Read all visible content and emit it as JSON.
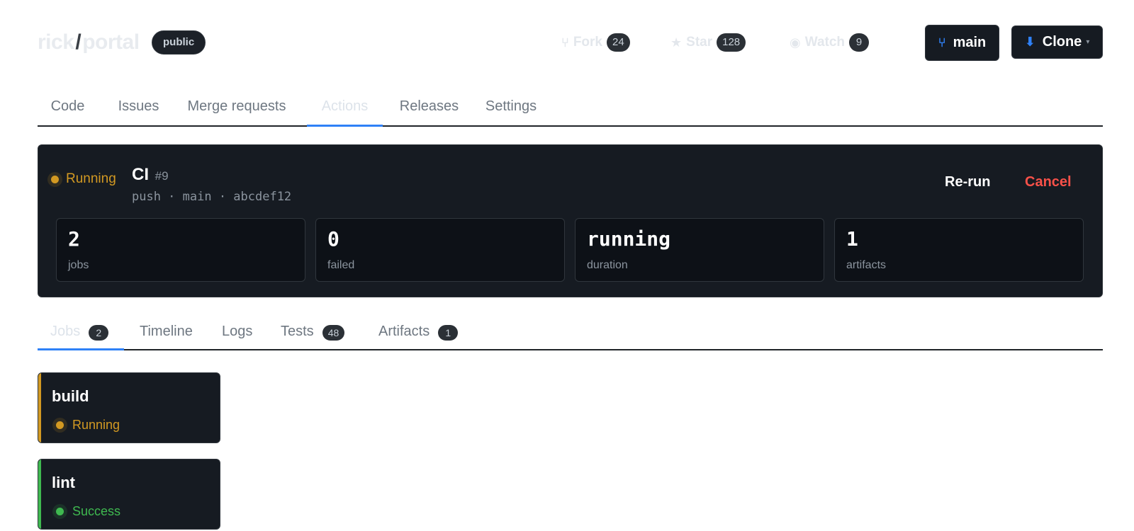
{
  "repo": {
    "owner": "rick",
    "separator": "/",
    "name": "portal",
    "visibility": "public",
    "fork": {
      "label": "Fork",
      "count": "24",
      "icon": "fork-icon"
    },
    "star": {
      "label": "Star",
      "count": "128",
      "icon": "star-icon"
    },
    "watch": {
      "label": "Watch",
      "count": "9",
      "icon": "eye-icon"
    },
    "branch_button": {
      "label": "main",
      "icon": "branch-icon"
    },
    "clone_button": {
      "label": "Clone",
      "icon": "download-icon"
    }
  },
  "repo_tabs": [
    {
      "label": "Code"
    },
    {
      "label": "Issues"
    },
    {
      "label": "Merge requests"
    },
    {
      "label": "Actions",
      "active": true
    },
    {
      "label": "Releases"
    },
    {
      "label": "Settings"
    }
  ],
  "run": {
    "status": "Running",
    "title": "CI",
    "number": "#9",
    "meta": "push · main · abcdef12",
    "rerun_label": "Re-run",
    "cancel_label": "Cancel",
    "stats": [
      {
        "value": "2",
        "label": "jobs"
      },
      {
        "value": "0",
        "label": "failed"
      },
      {
        "value": "running",
        "label": "duration"
      },
      {
        "value": "1",
        "label": "artifacts"
      }
    ]
  },
  "run_tabs": [
    {
      "label": "Jobs",
      "count": "2",
      "active": true
    },
    {
      "label": "Timeline"
    },
    {
      "label": "Logs"
    },
    {
      "label": "Tests",
      "count": "48"
    },
    {
      "label": "Artifacts",
      "count": "1"
    }
  ],
  "jobs": [
    {
      "name": "build",
      "status": "Running",
      "color": "#d29922"
    },
    {
      "name": "lint",
      "status": "Success",
      "color": "#3fb950"
    }
  ],
  "colors": {
    "accent": "#2f81f7",
    "running": "#d29922",
    "success": "#3fb950",
    "danger": "#f85149"
  }
}
